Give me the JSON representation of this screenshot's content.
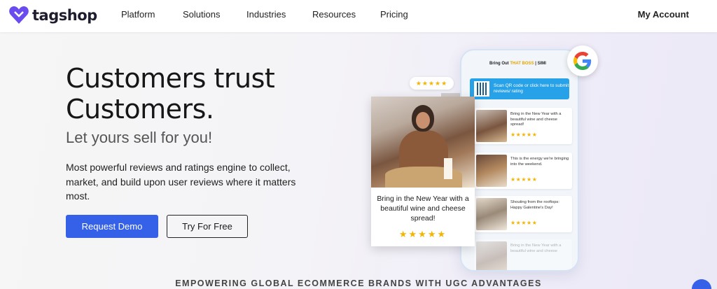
{
  "nav": {
    "logo_text": "tagshop",
    "items": [
      "Platform",
      "Solutions",
      "Industries",
      "Resources",
      "Pricing"
    ],
    "account_label": "My Account"
  },
  "hero": {
    "title_line1": "Customers trust",
    "title_line2": "Customers.",
    "subtitle": "Let yours sell for you!",
    "description": "Most powerful reviews and ratings engine to collect, market, and build upon user reviews where it matters most.",
    "primary_button": "Request Demo",
    "secondary_button": "Try For Free"
  },
  "tagline": "EMPOWERING GLOBAL ECOMMERCE BRANDS WITH UGC ADVANTAGES",
  "mockup": {
    "brand_prefix": "Bring Out",
    "brand_highlight": "THAT BOSS",
    "brand_suffix": "| SIMI",
    "qr_text": "Scan QR code or click here to submit reviews/ rating",
    "reviews": [
      {
        "text": "Bring in the New Year with a beautiful wine and cheese spread!",
        "stars": "★★★★★"
      },
      {
        "text": "This is the energy we're bringing into the weekend.",
        "stars": "★★★★★"
      },
      {
        "text": "Shouting from the rooftops: Happy Galentine's Day!",
        "stars": "★★★★★"
      },
      {
        "text": "Bring in the New Year with a beautiful wine and cheese",
        "stars": ""
      }
    ],
    "floating_stars": "★★★★★",
    "card_text": "Bring in the New Year with a beautiful wine and cheese spread!",
    "card_stars": "★★★★★"
  },
  "colors": {
    "primary": "#3461e8",
    "star": "#f4b400",
    "qr_banner": "#27a1e8"
  }
}
